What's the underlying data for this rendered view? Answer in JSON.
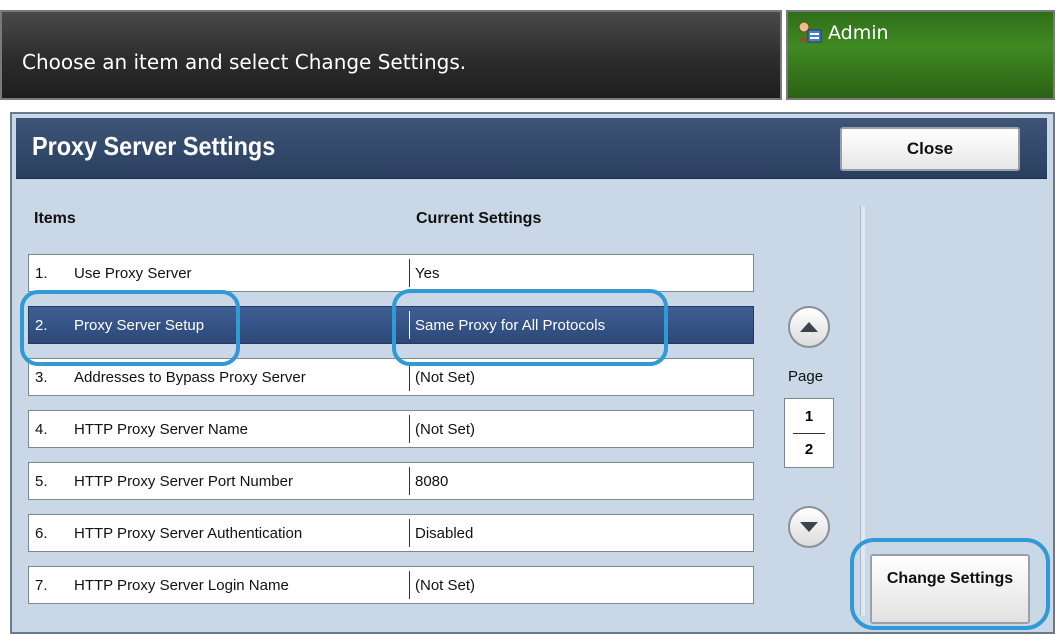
{
  "message": "Choose an item and select Change Settings.",
  "user": {
    "label": "Admin",
    "icon": "admin-user-icon"
  },
  "panel": {
    "title": "Proxy Server Settings",
    "close_label": "Close",
    "columns": {
      "items": "Items",
      "current": "Current Settings"
    }
  },
  "rows": [
    {
      "num": "1.",
      "name": "Use Proxy Server",
      "value": "Yes"
    },
    {
      "num": "2.",
      "name": "Proxy Server Setup",
      "value": "Same Proxy for All Protocols"
    },
    {
      "num": "3.",
      "name": "Addresses to Bypass Proxy Server",
      "value": "(Not Set)"
    },
    {
      "num": "4.",
      "name": "HTTP Proxy Server Name",
      "value": "(Not Set)"
    },
    {
      "num": "5.",
      "name": "HTTP Proxy Server Port Number",
      "value": "8080"
    },
    {
      "num": "6.",
      "name": "HTTP Proxy Server Authentication",
      "value": "Disabled"
    },
    {
      "num": "7.",
      "name": "HTTP Proxy Server Login Name",
      "value": "(Not Set)"
    }
  ],
  "pager": {
    "label": "Page",
    "current": "1",
    "total": "2"
  },
  "change_settings_label": "Change Settings",
  "colors": {
    "selected_row": "#2c4878",
    "highlight": "#2f9ad6",
    "admin_green": "#3f8a22",
    "header_navy": "#2a3f60"
  }
}
